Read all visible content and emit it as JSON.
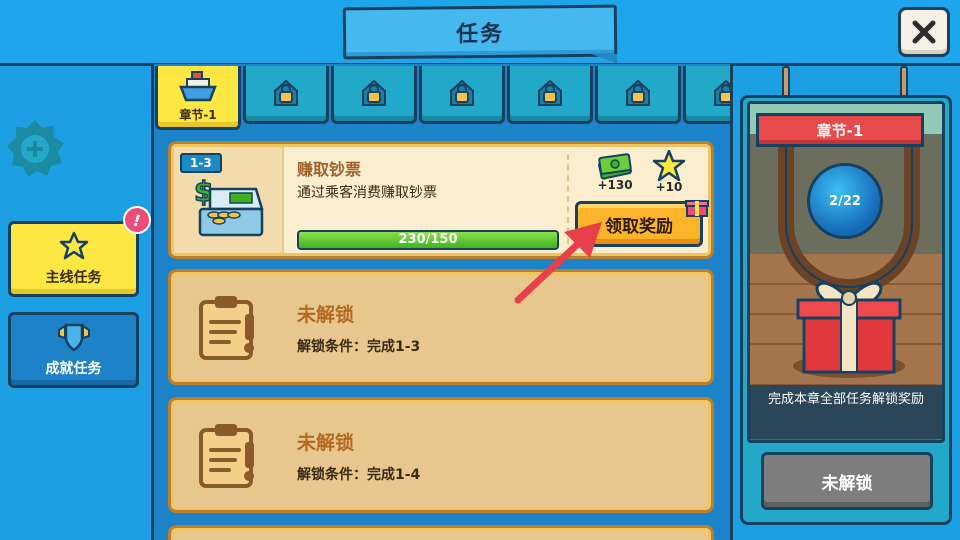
{
  "header": {
    "title": "任务"
  },
  "sidebar": {
    "items": [
      {
        "label": "主线任务",
        "active": true
      },
      {
        "label": "成就任务",
        "active": false
      }
    ],
    "alert_badge": "!"
  },
  "chapter_tabs": [
    {
      "label": "章节-1",
      "locked": false
    },
    {
      "locked": true
    },
    {
      "locked": true
    },
    {
      "locked": true
    },
    {
      "locked": true
    },
    {
      "locked": true
    },
    {
      "locked": true
    }
  ],
  "tasks": [
    {
      "level": "1-3",
      "title": "赚取钞票",
      "description": "通过乘客消费赚取钞票",
      "progress_text": "230/150",
      "progress_fraction": 1.0,
      "rewards": [
        {
          "icon": "cash-icon",
          "value": "+130"
        },
        {
          "icon": "star-icon",
          "value": "+10"
        }
      ],
      "claim_label": "领取奖励"
    }
  ],
  "locked_tasks": [
    {
      "title": "未解锁",
      "condition": "解锁条件：完成1-3"
    },
    {
      "title": "未解锁",
      "condition": "解锁条件：完成1-4"
    }
  ],
  "chapter_reward": {
    "ribbon": "章节-1",
    "progress": "2/22",
    "description": "完成本章全部任务解锁奖励",
    "button_label": "未解锁"
  },
  "colors": {
    "background": "#1d9fe3",
    "accent_yellow": "#fde743",
    "claim_orange": "#fdb42a",
    "ribbon_red": "#e74a4a",
    "arrow_red": "#e8404a",
    "outline": "#17415f"
  }
}
